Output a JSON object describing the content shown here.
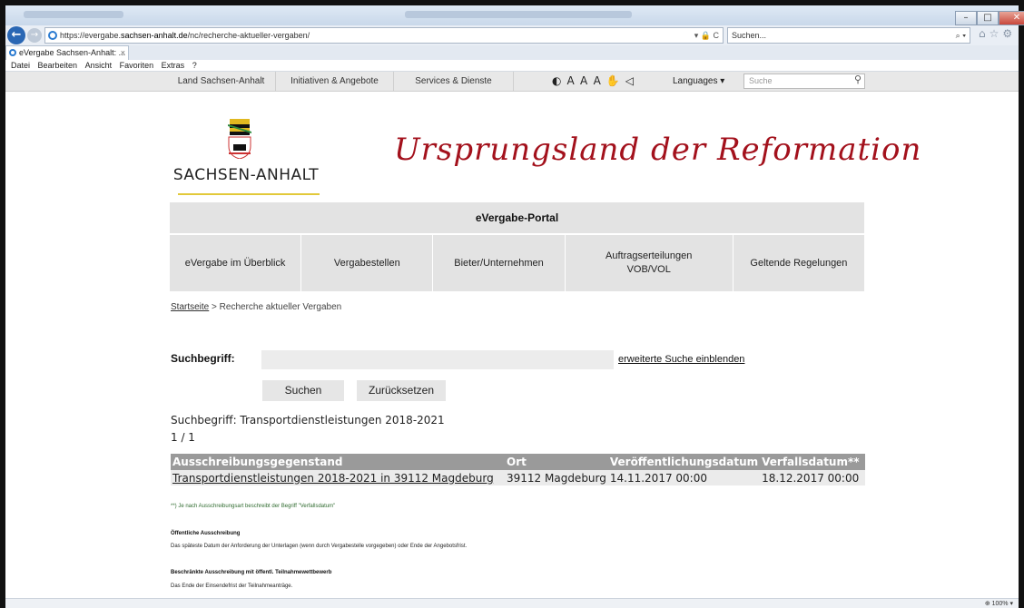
{
  "browser": {
    "url_prefix": "https://evergabe.",
    "url_host": "sachsen-anhalt.de",
    "url_path": "/nc/recherche-aktueller-vergaben/",
    "address_tools": "▾ 🔒 C",
    "search_placeholder": "Suchen...",
    "tab_title": "eVergabe Sachsen-Anhalt: ...",
    "tab_close": "×",
    "menu": [
      "Datei",
      "Bearbeiten",
      "Ansicht",
      "Favoriten",
      "Extras",
      "?"
    ],
    "zoom": "100%"
  },
  "sitebar": {
    "items": [
      "Land Sachsen-Anhalt",
      "Initiativen & Angebote",
      "Services & Dienste"
    ],
    "languages": "Languages ▾",
    "search_placeholder": "Suche"
  },
  "header": {
    "logo_text": "SACHSEN-ANHALT",
    "slogan": "Ursprungsland der Reformation"
  },
  "portal_title": "eVergabe-Portal",
  "main_nav": [
    "eVergabe im Überblick",
    "Vergabestellen",
    "Bieter/Unternehmen",
    "Auftragserteilungen VOB/VOL",
    "Geltende Regelungen"
  ],
  "breadcrumb": {
    "home": "Startseite",
    "separator": " > ",
    "current": "Recherche aktueller Vergaben"
  },
  "search": {
    "label": "Suchbegriff:",
    "value": "",
    "advanced_link": "erweiterte Suche einblenden",
    "submit_label": "Suchen",
    "reset_label": "Zurücksetzen"
  },
  "results": {
    "query_text": "Suchbegriff: Transportdienstleistungen 2018-2021",
    "pager": "1 / 1",
    "columns": [
      "Ausschreibungsgegenstand",
      "Ort",
      "Veröffentlichungsdatum",
      "Verfallsdatum**"
    ],
    "rows": [
      {
        "subject": "Transportdienstleistungen 2018-2021 in 39112 Magdeburg",
        "ort": "39112 Magdeburg",
        "published": "14.11.2017 00:00",
        "expires": "18.12.2017 00:00"
      }
    ]
  },
  "footnote": "**) Je nach Ausschreibungsart beschreibt der Begriff \"Verfallsdatum\"",
  "explanations": [
    {
      "heading": "Öffentliche Ausschreibung",
      "text": "Das späteste Datum der Anforderung der Unterlagen (wenn durch Vergabestelle vorgegeben) oder Ende der Angebotsfrist."
    },
    {
      "heading": "Beschränkte Ausschreibung mit öffentl. Teilnahmewettbewerb",
      "text": "Das Ende der Einsendefrist der Teilnahmeanträge."
    }
  ],
  "colors": {
    "slogan": "#a3111c",
    "table_header": "#9a9a9a",
    "nav_bg": "#e3e3e3"
  }
}
